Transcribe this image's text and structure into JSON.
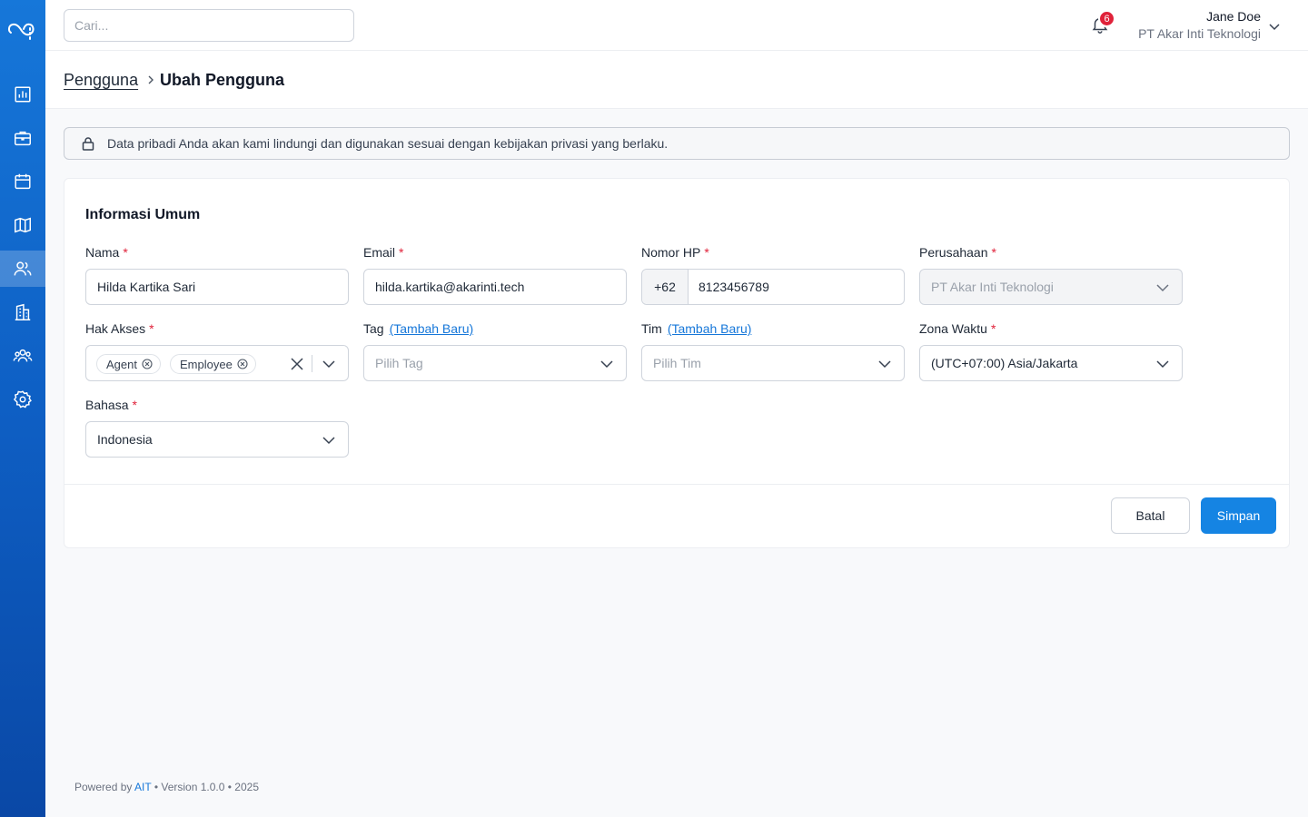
{
  "header": {
    "search_placeholder": "Cari...",
    "notification_count": "6",
    "user_name": "Jane Doe",
    "user_company": "PT Akar Inti Teknologi"
  },
  "breadcrumb": {
    "parent": "Pengguna",
    "current": "Ubah Pengguna"
  },
  "notice": {
    "text": "Data pribadi Anda akan kami lindungi dan digunakan sesuai dengan kebijakan privasi yang berlaku."
  },
  "form": {
    "title": "Informasi Umum",
    "required_mark": "*",
    "add_new_label": "(Tambah Baru)",
    "name": {
      "label": "Nama",
      "value": "Hilda Kartika Sari"
    },
    "email": {
      "label": "Email",
      "value": "hilda.kartika@akarinti.tech"
    },
    "phone": {
      "label": "Nomor HP",
      "prefix": "+62",
      "value": "8123456789"
    },
    "company": {
      "label": "Perusahaan",
      "value": "PT Akar Inti Teknologi"
    },
    "access": {
      "label": "Hak Akses",
      "tags": [
        "Agent",
        "Employee"
      ]
    },
    "tag": {
      "label": "Tag",
      "placeholder": "Pilih Tag"
    },
    "team": {
      "label": "Tim",
      "placeholder": "Pilih Tim"
    },
    "timezone": {
      "label": "Zona Waktu",
      "value": "(UTC+07:00) Asia/Jakarta"
    },
    "language": {
      "label": "Bahasa",
      "value": "Indonesia"
    },
    "cancel_label": "Batal",
    "save_label": "Simpan"
  },
  "footer": {
    "prefix": "Powered by",
    "brand": "AIT",
    "suffix": "• Version 1.0.0 • 2025"
  },
  "sidebar": {
    "items": [
      "chart-icon",
      "briefcase-icon",
      "calendar-icon",
      "map-icon",
      "users-icon",
      "building-icon",
      "team-icon",
      "gear-icon"
    ],
    "active_item": "users-icon"
  },
  "colors": {
    "primary": "#1584e3",
    "required": "#e0223a",
    "sidebar_top": "#1677d9",
    "sidebar_bottom": "#0a48a6"
  }
}
